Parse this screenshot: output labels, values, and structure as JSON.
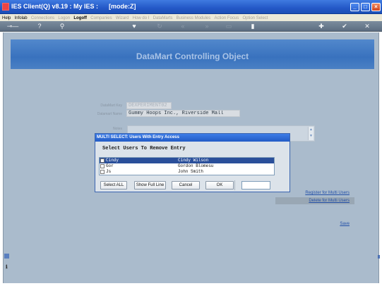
{
  "window": {
    "title": "IES Client(Q) v8.19 : My IES :      [mode:Z]",
    "buttons": [
      "_",
      "□",
      "×"
    ]
  },
  "menu": [
    {
      "label": "Help",
      "enabled": true
    },
    {
      "label": "Infolab",
      "enabled": true
    },
    {
      "label": "Connections",
      "enabled": false
    },
    {
      "label": "Logon",
      "enabled": false
    },
    {
      "label": "Logoff",
      "enabled": true
    },
    {
      "label": "Companies",
      "enabled": false
    },
    {
      "label": "Wizard",
      "enabled": false
    },
    {
      "label": "How do I",
      "enabled": false
    },
    {
      "label": "DataMarts",
      "enabled": false
    },
    {
      "label": "Business Modules",
      "enabled": false
    },
    {
      "label": "Action Focus",
      "enabled": false
    },
    {
      "label": "Option Select",
      "enabled": false
    }
  ],
  "toolbar": {
    "icons": [
      "key-icon",
      "help-icon",
      "search-icon",
      "heart-icon",
      "refresh-icon",
      "back-icon",
      "forward-icon",
      "page-icon",
      "clipboard-icon",
      "add-icon",
      "check-icon",
      "close-icon"
    ]
  },
  "page": {
    "banner_title": "DataMart Controlling Object",
    "fields": {
      "key_label": "DataMart Key",
      "key_value": "DEXPERIMENT02",
      "name_label": "Datamart Name",
      "name_value": "Gummy Hoops Inc., Riverside Mall",
      "notes_label": "Notes"
    },
    "links": {
      "register": "Register for Multi Users",
      "delete": "Delete for Multi Users",
      "save": "Save"
    }
  },
  "dialog": {
    "title": "MULTI SELECT: Users With Entry Access",
    "heading": "Select Users To Remove Entry",
    "users": [
      {
        "code": "Cindy",
        "name": "Cindy Wilson",
        "selected": true
      },
      {
        "code": "Gor",
        "name": "Gordon Blomesu",
        "selected": false
      },
      {
        "code": "Js",
        "name": "John Smith",
        "selected": false
      }
    ],
    "buttons": {
      "select_all": "Select ALL",
      "show_full": "Show Full Line",
      "cancel": "Cancel",
      "ok": "OK"
    }
  },
  "colors": {
    "titlebar": "#2458c7",
    "workspace": "#aabbcc",
    "banner": "#3972be",
    "selection": "#2a4f9a",
    "link": "#2350a8"
  }
}
